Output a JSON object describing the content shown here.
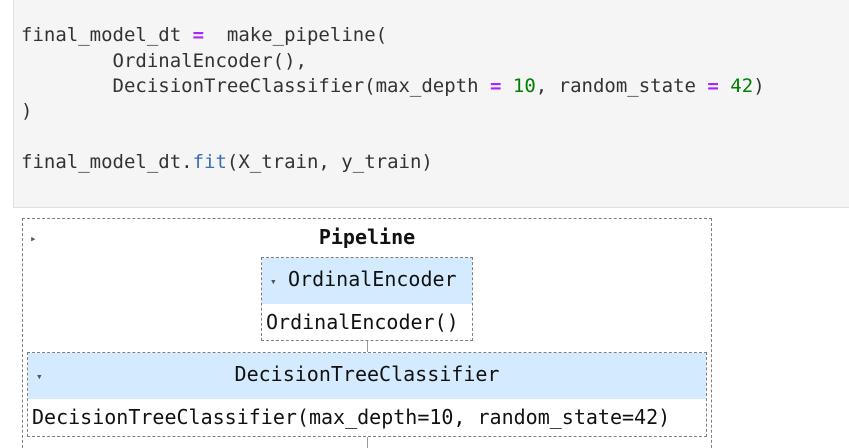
{
  "code": {
    "line1": {
      "pre": "final_model_dt ",
      "op": "=",
      "post": "  make_pipeline("
    },
    "line2": {
      "text": "        OrdinalEncoder(),"
    },
    "line3": {
      "pre": "        DecisionTreeClassifier(max_depth ",
      "op1": "=",
      "mid1": " ",
      "num1": "10",
      "mid2": ", random_state ",
      "op2": "=",
      "mid3": " ",
      "num2": "42",
      "post": ")"
    },
    "line4": {
      "text": ")"
    },
    "line5": {
      "pre": "final_model_dt.",
      "attr": "fit",
      "post": "(X_train, y_train)"
    }
  },
  "pipeline": {
    "toggle_icon": "▸",
    "title": "Pipeline",
    "steps": [
      {
        "toggle_icon": "▾",
        "name": "OrdinalEncoder",
        "repr": "OrdinalEncoder()"
      },
      {
        "toggle_icon": "▾",
        "name": "DecisionTreeClassifier",
        "repr": "DecisionTreeClassifier(max_depth=10, random_state=42)"
      }
    ]
  },
  "colors": {
    "code_background": "#f5f5f5",
    "operator": "#aa22ff",
    "number": "#008000",
    "attribute": "#3a6fb0",
    "estimator_header": "#d4ebff"
  }
}
